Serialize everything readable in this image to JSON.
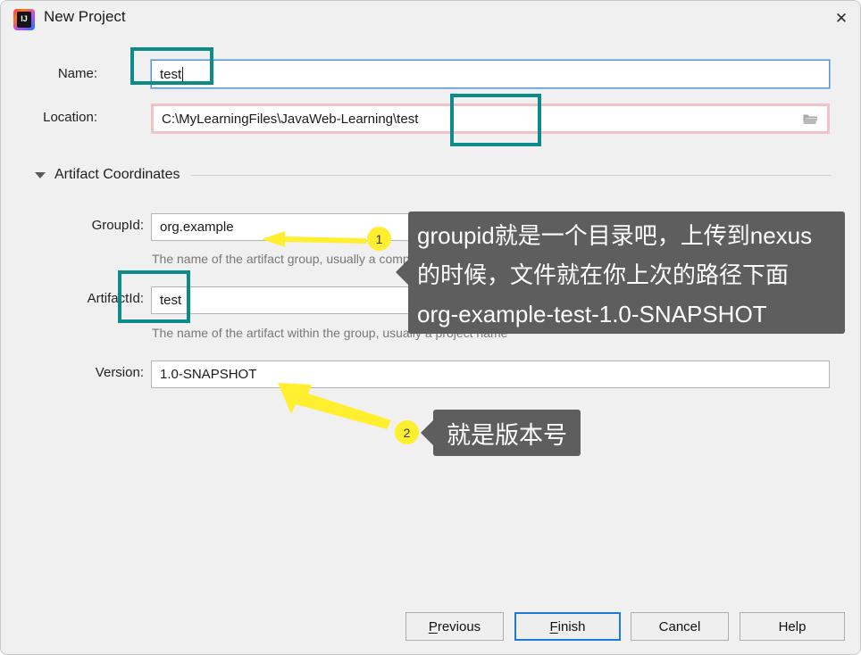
{
  "window": {
    "title": "New Project",
    "app_icon": "intellij-idea-icon",
    "close_icon": "close-icon"
  },
  "form": {
    "name": {
      "label": "Name:",
      "value": "test",
      "focused": true
    },
    "location": {
      "label": "Location:",
      "value": "C:\\MyLearningFiles\\JavaWeb-Learning\\test",
      "browse_icon": "folder-icon",
      "error": true
    },
    "section": {
      "title": "Artifact Coordinates",
      "expanded": true,
      "collapse_icon": "triangle-down-icon"
    },
    "group_id": {
      "label": "GroupId:",
      "value": "org.example",
      "helper": "The name of the artifact group, usually a company domain"
    },
    "artifact_id": {
      "label": "ArtifactId:",
      "value": "test",
      "helper": "The name of the artifact within the group, usually a project name"
    },
    "version": {
      "label": "Version:",
      "value": "1.0-SNAPSHOT"
    }
  },
  "buttons": {
    "previous": {
      "label": "Previous",
      "mnemonic": "P"
    },
    "finish": {
      "label": "Finish",
      "mnemonic": "F",
      "default": true
    },
    "cancel": {
      "label": "Cancel"
    },
    "help": {
      "label": "Help"
    }
  },
  "annotations": {
    "callout1": {
      "badge": "1",
      "lines": [
        "groupid就是一个目录吧，上传到nexus",
        "的时候，文件就在你上次的路径下面",
        "org-example-test-1.0-SNAPSHOT"
      ]
    },
    "callout2": {
      "badge": "2",
      "lines": [
        "就是版本号"
      ]
    },
    "colors": {
      "highlight_box": "#0d8b8b",
      "arrow": "#ffef2e",
      "callout_bg": "#5e5e5e",
      "error_border": "#f1c3c9",
      "focus_border": "#5794d0"
    }
  }
}
